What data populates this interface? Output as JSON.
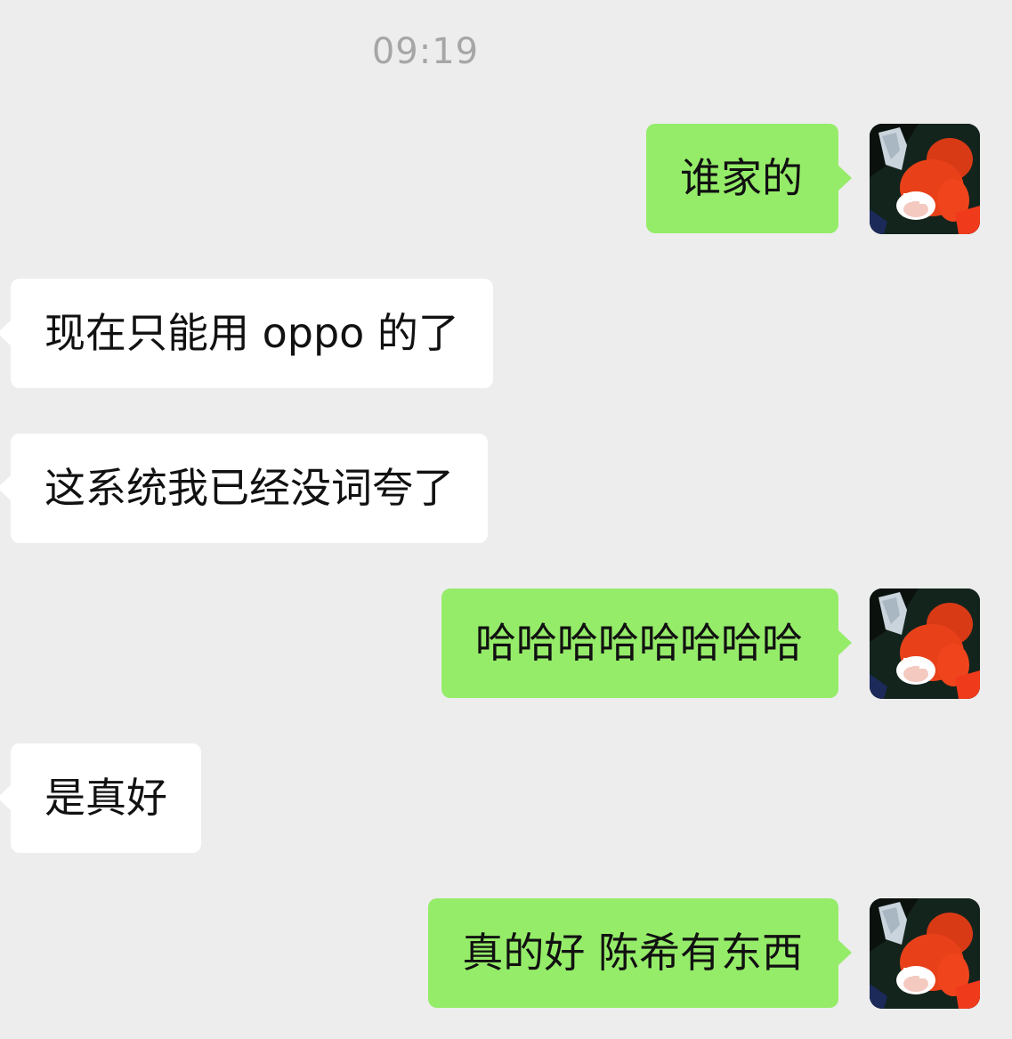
{
  "chat": {
    "timestamp": "09:19",
    "messages": [
      {
        "side": "out",
        "text": "谁家的",
        "avatar_icon": "cartoon-avatar"
      },
      {
        "side": "in",
        "text": "现在只能用 oppo 的了"
      },
      {
        "side": "in",
        "text": "这系统我已经没词夸了"
      },
      {
        "side": "out",
        "text": "哈哈哈哈哈哈哈哈",
        "avatar_icon": "cartoon-avatar"
      },
      {
        "side": "in",
        "text": "是真好"
      },
      {
        "side": "out",
        "text": "真的好 陈希有东西",
        "avatar_icon": "cartoon-avatar"
      }
    ]
  },
  "colors": {
    "background": "#ededed",
    "outgoing_bubble": "#95ec69",
    "incoming_bubble": "#ffffff",
    "timestamp_text": "#a6a6a6",
    "message_text": "#111111"
  }
}
